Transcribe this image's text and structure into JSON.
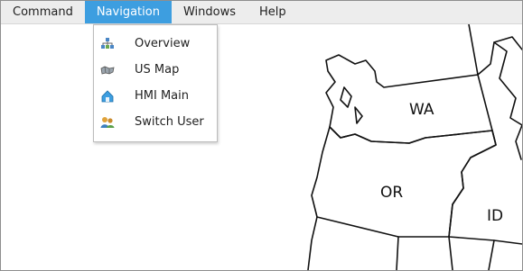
{
  "menubar": {
    "items": [
      {
        "label": "Command"
      },
      {
        "label": "Navigation",
        "active": true
      },
      {
        "label": "Windows"
      },
      {
        "label": "Help"
      }
    ]
  },
  "navigation_menu": {
    "items": [
      {
        "label": "Overview",
        "icon": "overview-icon"
      },
      {
        "label": "US Map",
        "icon": "us-map-icon"
      },
      {
        "label": "HMI Main",
        "icon": "hmi-main-icon"
      },
      {
        "label": "Switch User",
        "icon": "switch-user-icon"
      }
    ]
  },
  "map": {
    "states": [
      {
        "label": "WA"
      },
      {
        "label": "OR"
      },
      {
        "label": "ID"
      }
    ]
  },
  "colors": {
    "menu_active": "#3d9ee0",
    "menubar_bg": "#ededed"
  }
}
